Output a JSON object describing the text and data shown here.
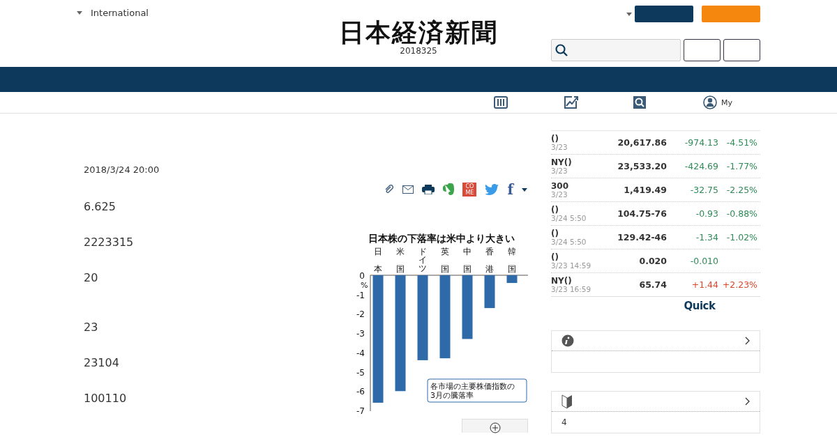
{
  "header": {
    "edition": "International",
    "logo": "日本経済新聞",
    "date": "2018325"
  },
  "nav_icons": [
    {
      "kind": "grid"
    },
    {
      "kind": "chart"
    },
    {
      "kind": "search"
    },
    {
      "kind": "person",
      "label": "My"
    }
  ],
  "article": {
    "timestamp": "2018/3/24 20:00",
    "share_icons": [
      {
        "kind": "clip"
      },
      {
        "kind": "mail"
      },
      {
        "kind": "print"
      },
      {
        "kind": "elephant"
      },
      {
        "kind": "come",
        "lines": [
          "CO",
          "ME"
        ]
      },
      {
        "kind": "bird"
      },
      {
        "kind": "f",
        "label": "f"
      },
      {
        "kind": "caret"
      }
    ],
    "sections": [
      [
        "6.625",
        "2223315",
        "20"
      ],
      [
        "23",
        "23104",
        "100110"
      ]
    ],
    "figure": {
      "chart_data": {
        "type": "bar",
        "title": "日本株の下落率は米中より大きい",
        "ylabel": "%",
        "categories": [
          "日本",
          "米国",
          "ドイツ",
          "英国",
          "中国",
          "香港",
          "韓国"
        ],
        "values": [
          -6.6,
          -6.0,
          -4.4,
          -4.3,
          -3.3,
          -1.7,
          -0.4
        ],
        "ylim": [
          -7,
          0
        ],
        "yticks": [
          0,
          -1,
          -2,
          -3,
          -4,
          -5,
          -6,
          -7
        ],
        "annotations": [
          "各市場の主要株価指数の",
          "3月の騰落率"
        ]
      }
    }
  },
  "markets": [
    {
      "name": "()",
      "date": "3/23",
      "value": "20,617.86",
      "change": "-974.13",
      "percent": "-4.51%",
      "color": "#2e8b57"
    },
    {
      "name": "NY()",
      "date": "3/23",
      "value": "23,533.20",
      "change": "-424.69",
      "percent": "-1.77%",
      "color": "#2e8b57"
    },
    {
      "name": "300",
      "date": "3/23",
      "value": "1,419.49",
      "change": "-32.75",
      "percent": "-2.25%",
      "color": "#2e8b57"
    },
    {
      "name": "()",
      "date": "3/24 5:50",
      "value": "104.75-76",
      "change": "-0.93",
      "percent": "-0.88%",
      "color": "#2e8b57"
    },
    {
      "name": "()",
      "date": "3/24 5:50",
      "value": "129.42-46",
      "change": "-1.34",
      "percent": "-1.02%",
      "color": "#2e8b57"
    },
    {
      "name": "()",
      "date": "3/23 14:59",
      "value": "0.020",
      "change": "-0.010",
      "color": "#2e8b57"
    },
    {
      "name": "NY()",
      "date": "3/23 16:59",
      "value": "65.74",
      "change": "+1.44",
      "percent": "+2.23%",
      "color": "#d9482b"
    }
  ],
  "quick_logo": "Quick",
  "side_boxes": [
    {
      "kind": "info"
    },
    {
      "kind": "leaf",
      "body": "4"
    }
  ]
}
